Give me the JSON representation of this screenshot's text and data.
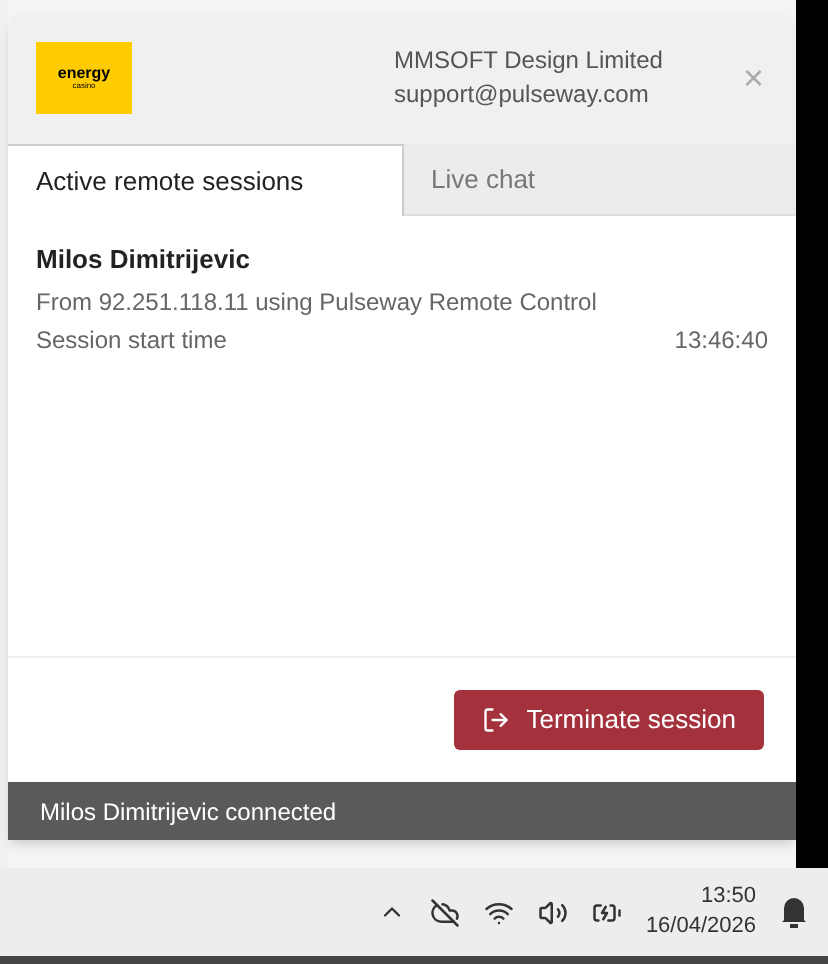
{
  "logo": {
    "word": "energy",
    "subword": "casino"
  },
  "header": {
    "company": "MMSOFT Design Limited",
    "email": "support@pulseway.com",
    "close": "×"
  },
  "tabs": [
    {
      "label": "Active remote sessions",
      "selected": true
    },
    {
      "label": "Live chat",
      "selected": false
    }
  ],
  "session": {
    "user": "Milos Dimitrijevic",
    "detail": "From 92.251.118.11 using Pulseway Remote Control",
    "start_label": "Session start time",
    "start_time": "13:46:40"
  },
  "terminate_button": "Terminate session",
  "status_bar": "Milos Dimitrijevic connected",
  "taskbar": {
    "time": "13:50",
    "date": "16/04/2026"
  }
}
